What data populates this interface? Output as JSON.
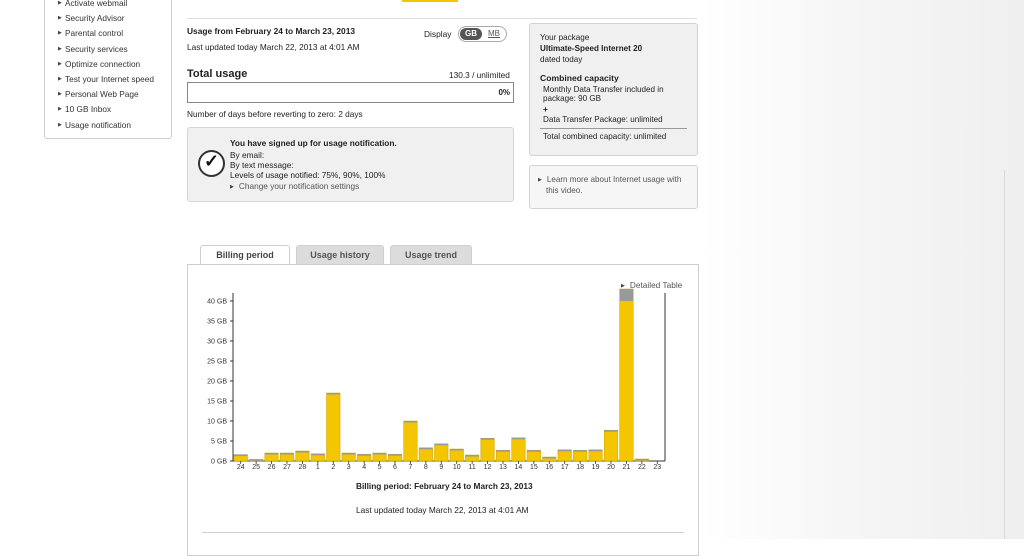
{
  "sidebar": {
    "items": [
      {
        "label": "Activate webmail"
      },
      {
        "label": "Security Advisor"
      },
      {
        "label": "Parental control"
      },
      {
        "label": "Security services"
      },
      {
        "label": "Optimize connection"
      },
      {
        "label": "Test your Internet speed"
      },
      {
        "label": "Personal Web Page"
      },
      {
        "label": "10 GB Inbox"
      },
      {
        "label": "Usage notification"
      }
    ]
  },
  "summary": {
    "range": "Usage from February 24 to March 23, 2013",
    "updated": "Last updated today March 22, 2013 at 4:01 AM",
    "display_label": "Display",
    "unit_gb": "GB",
    "unit_mb": "MB",
    "total_label": "Total usage",
    "total_value": "130.3 / unlimited",
    "percent": "0%",
    "days_text": "Number of days before reverting to zero: 2 days"
  },
  "notification": {
    "title": "You have signed up for usage notification.",
    "email": "By email:",
    "text": "By text message:",
    "levels": "Levels of usage notified: 75%, 90%, 100%",
    "change_link": "Change your notification settings"
  },
  "package": {
    "your_package": "Your package",
    "name": "Ultimate-Speed Internet 20",
    "dated": "dated today",
    "combined_title": "Combined capacity",
    "monthly_line1": "Monthly Data Transfer included in",
    "monthly_line2": "package: 90 GB",
    "plus": "+",
    "transfer_pkg": "Data Transfer Package: unlimited",
    "total": "Total combined capacity: unlimited"
  },
  "learn": {
    "line1": "Learn more about Internet usage with",
    "line2": "this video."
  },
  "tabs": [
    {
      "label": "Billing period"
    },
    {
      "label": "Usage history"
    },
    {
      "label": "Usage trend"
    }
  ],
  "chart_panel": {
    "detailed_link": "Detailed Table",
    "period_label": "Billing period: February 24 to March 23, 2013",
    "last_updated": "Last updated today March 22, 2013 at 4:01 AM"
  },
  "colors": {
    "bar_yellow": "#f3c600",
    "bar_top": "#999999"
  },
  "chart_data": {
    "type": "bar",
    "title": "",
    "ylabel": "",
    "xlabel": "",
    "ylim": [
      0,
      42
    ],
    "yticks": [
      "0 GB",
      "5 GB",
      "10 GB",
      "15 GB",
      "20 GB",
      "25 GB",
      "30 GB",
      "35 GB",
      "40 GB"
    ],
    "categories": [
      "24",
      "25",
      "26",
      "27",
      "28",
      "1",
      "2",
      "3",
      "4",
      "5",
      "6",
      "7",
      "8",
      "9",
      "10",
      "11",
      "12",
      "13",
      "14",
      "15",
      "16",
      "17",
      "18",
      "19",
      "20",
      "21",
      "22",
      "23"
    ],
    "series": [
      {
        "values": [
          1.6,
          0.4,
          2.0,
          2.0,
          2.5,
          1.8,
          17.0,
          2.0,
          1.7,
          2.0,
          1.7,
          10.0,
          3.3,
          4.3,
          3.0,
          1.5,
          5.7,
          2.7,
          5.8,
          2.7,
          1.0,
          2.8,
          2.7,
          2.8,
          7.7,
          43.0,
          0.5,
          0.0
        ]
      }
    ]
  }
}
